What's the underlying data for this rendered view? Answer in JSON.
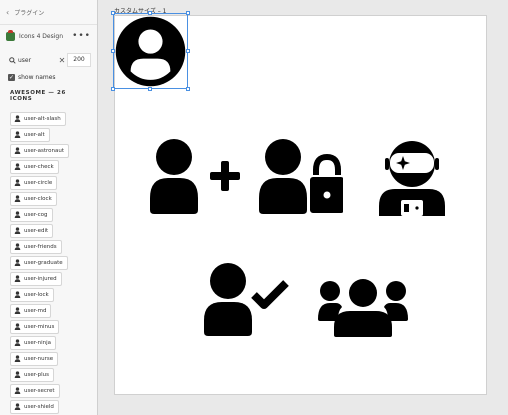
{
  "panel": {
    "back_label": "プラグイン",
    "plugin_name": "Icons 4 Design",
    "more_label": "•••",
    "search_value": "user",
    "clear_label": "✕",
    "count_value": "200",
    "show_names_label": "show names",
    "section_title": "AWESOME — 26 ICONS",
    "items": [
      {
        "label": "user-alt-slash",
        "icon": "user-alt-slash-icon"
      },
      {
        "label": "user-alt",
        "icon": "user-alt-icon"
      },
      {
        "label": "user-astronaut",
        "icon": "user-astronaut-icon"
      },
      {
        "label": "user-check",
        "icon": "user-check-icon"
      },
      {
        "label": "user-circle",
        "icon": "user-circle-icon"
      },
      {
        "label": "user-clock",
        "icon": "user-clock-icon"
      },
      {
        "label": "user-cog",
        "icon": "user-cog-icon"
      },
      {
        "label": "user-edit",
        "icon": "user-edit-icon"
      },
      {
        "label": "user-friends",
        "icon": "user-friends-icon"
      },
      {
        "label": "user-graduate",
        "icon": "user-graduate-icon"
      },
      {
        "label": "user-injured",
        "icon": "user-injured-icon"
      },
      {
        "label": "user-lock",
        "icon": "user-lock-icon"
      },
      {
        "label": "user-md",
        "icon": "user-md-icon"
      },
      {
        "label": "user-minus",
        "icon": "user-minus-icon"
      },
      {
        "label": "user-ninja",
        "icon": "user-ninja-icon"
      },
      {
        "label": "user-nurse",
        "icon": "user-nurse-icon"
      },
      {
        "label": "user-plus",
        "icon": "user-plus-icon"
      },
      {
        "label": "user-secret",
        "icon": "user-secret-icon"
      },
      {
        "label": "user-shield",
        "icon": "user-shield-icon"
      }
    ]
  },
  "canvas": {
    "artboard_label": "カスタムサイズ – 1"
  },
  "colors": {
    "selection": "#4a90e2",
    "icon_fill": "#000000"
  }
}
